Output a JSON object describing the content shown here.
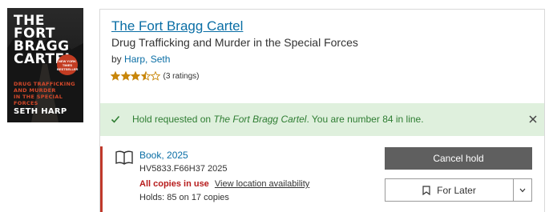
{
  "cover": {
    "title_line1": "THE",
    "title_line2": "FORT",
    "title_line3": "BRAGG",
    "title_line4": "CARTEL",
    "subtitle_line1": "DRUG TRAFFICKING",
    "subtitle_line2": "AND MURDER",
    "subtitle_line3": "IN THE SPECIAL FORCES",
    "author": "SETH HARP",
    "badge": "NEW YORK TIMES BESTSELLER"
  },
  "book": {
    "title": "The Fort Bragg Cartel",
    "subtitle": "Drug Trafficking and Murder in the Special Forces",
    "by_prefix": "by",
    "author": "Harp, Seth",
    "rating_stars": 3.5,
    "rating_max": 5,
    "rating_count": "(3 ratings)"
  },
  "alert": {
    "prefix": "Hold requested on ",
    "title_italic": "The Fort Bragg Cartel",
    "suffix": ". You are number 84 in line."
  },
  "format": {
    "label": "Book, 2025",
    "call_number": "HV5833.F66H37 2025",
    "status": "All copies in use",
    "location_link": "View location availability",
    "holds": "Holds: 85 on 17 copies"
  },
  "actions": {
    "cancel_label": "Cancel hold",
    "later_label": "For Later"
  },
  "colors": {
    "link": "#0a6ea5",
    "alert_bg": "#dff0dd",
    "alert_text": "#2e7d32",
    "status_red": "#b71c1c",
    "accent_bar": "#c0392b",
    "button_dark": "#5f5f5f",
    "star": "#c8860a"
  }
}
